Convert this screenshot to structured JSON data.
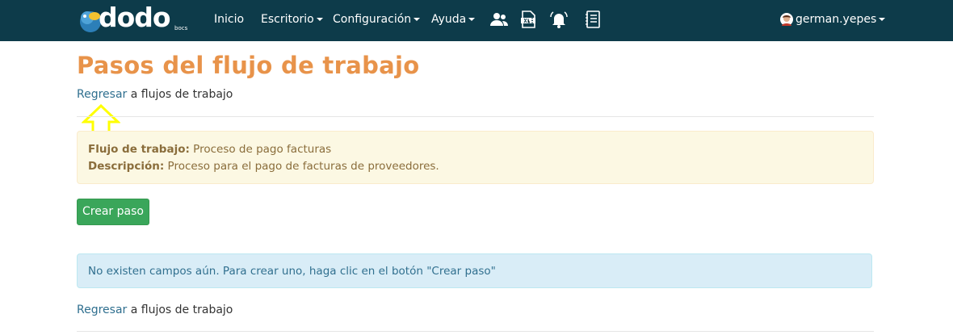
{
  "navbar": {
    "brand": {
      "logo_text": "dodo",
      "logo_sub": "bocs"
    },
    "menu": [
      {
        "label": "Inicio"
      },
      {
        "label": "Escritorio"
      },
      {
        "label": "Configuración"
      },
      {
        "label": "Ayuda"
      }
    ],
    "icons": [
      "users-icon",
      "xlsx-file-icon",
      "bell-icon",
      "document-list-icon"
    ],
    "user": {
      "name": "german.yepes"
    },
    "colors": {
      "background": "#0d3b4a",
      "text": "#ffffff"
    }
  },
  "page": {
    "title": "Pasos del flujo de trabajo",
    "back_link": {
      "link": "Regresar",
      "rest": " a flujos de trabajo"
    },
    "workflow": {
      "workflow_label": "Flujo de trabajo:",
      "workflow_value": " Proceso de pago facturas",
      "description_label": "Descripción:",
      "description_value": " Proceso para el pago de facturas de proveedores."
    },
    "create_button": "Crear paso",
    "empty_message": "No existen campos aún. Para crear uno, haga clic en el botón \"Crear paso\"",
    "footer_back_link": {
      "link": "Regresar",
      "rest": " a flujos de trabajo"
    }
  },
  "colors": {
    "title": "#e8934a",
    "link": "#2f6f8f",
    "warning_bg": "#fcf8e3",
    "info_bg": "#d9edf7",
    "button": "#3aa65a",
    "highlight_arrow": "#ffff00"
  }
}
